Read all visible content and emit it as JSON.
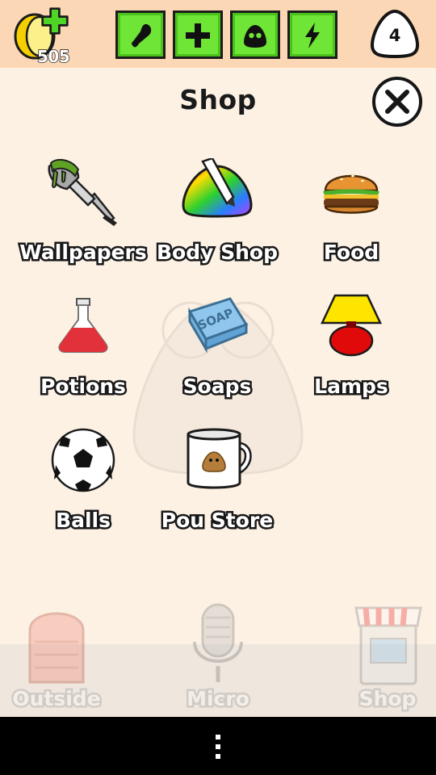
{
  "status": {
    "coins": "505",
    "level": "4",
    "stats": [
      {
        "name": "hunger",
        "icon": "chicken-leg-icon",
        "color": "#6fe535"
      },
      {
        "name": "health",
        "icon": "plus-icon",
        "color": "#6fe535"
      },
      {
        "name": "fun",
        "icon": "pou-face-icon",
        "color": "#6fe535"
      },
      {
        "name": "energy",
        "icon": "lightning-icon",
        "color": "#6fe535"
      }
    ]
  },
  "shop": {
    "title": "Shop",
    "items": [
      {
        "label": "Wallpapers",
        "icon": "paint-brush-icon"
      },
      {
        "label": "Body Shop",
        "icon": "color-palette-icon"
      },
      {
        "label": "Food",
        "icon": "burger-icon"
      },
      {
        "label": "Potions",
        "icon": "potion-flask-icon"
      },
      {
        "label": "Soaps",
        "icon": "soap-icon"
      },
      {
        "label": "Lamps",
        "icon": "lamp-icon"
      },
      {
        "label": "Balls",
        "icon": "soccer-ball-icon"
      },
      {
        "label": "Pou Store",
        "icon": "pou-mug-icon"
      }
    ],
    "soap_text": "SOAP"
  },
  "bottom_nav": [
    {
      "label": "Outside",
      "icon": "door-icon"
    },
    {
      "label": "Micro",
      "icon": "microphone-icon"
    },
    {
      "label": "Shop",
      "icon": "shop-icon"
    }
  ],
  "colors": {
    "top_bar": "#fbd7b5",
    "background": "#fdf1e4",
    "stat_green": "#6fe535",
    "coin_yellow": "#f5d000"
  }
}
